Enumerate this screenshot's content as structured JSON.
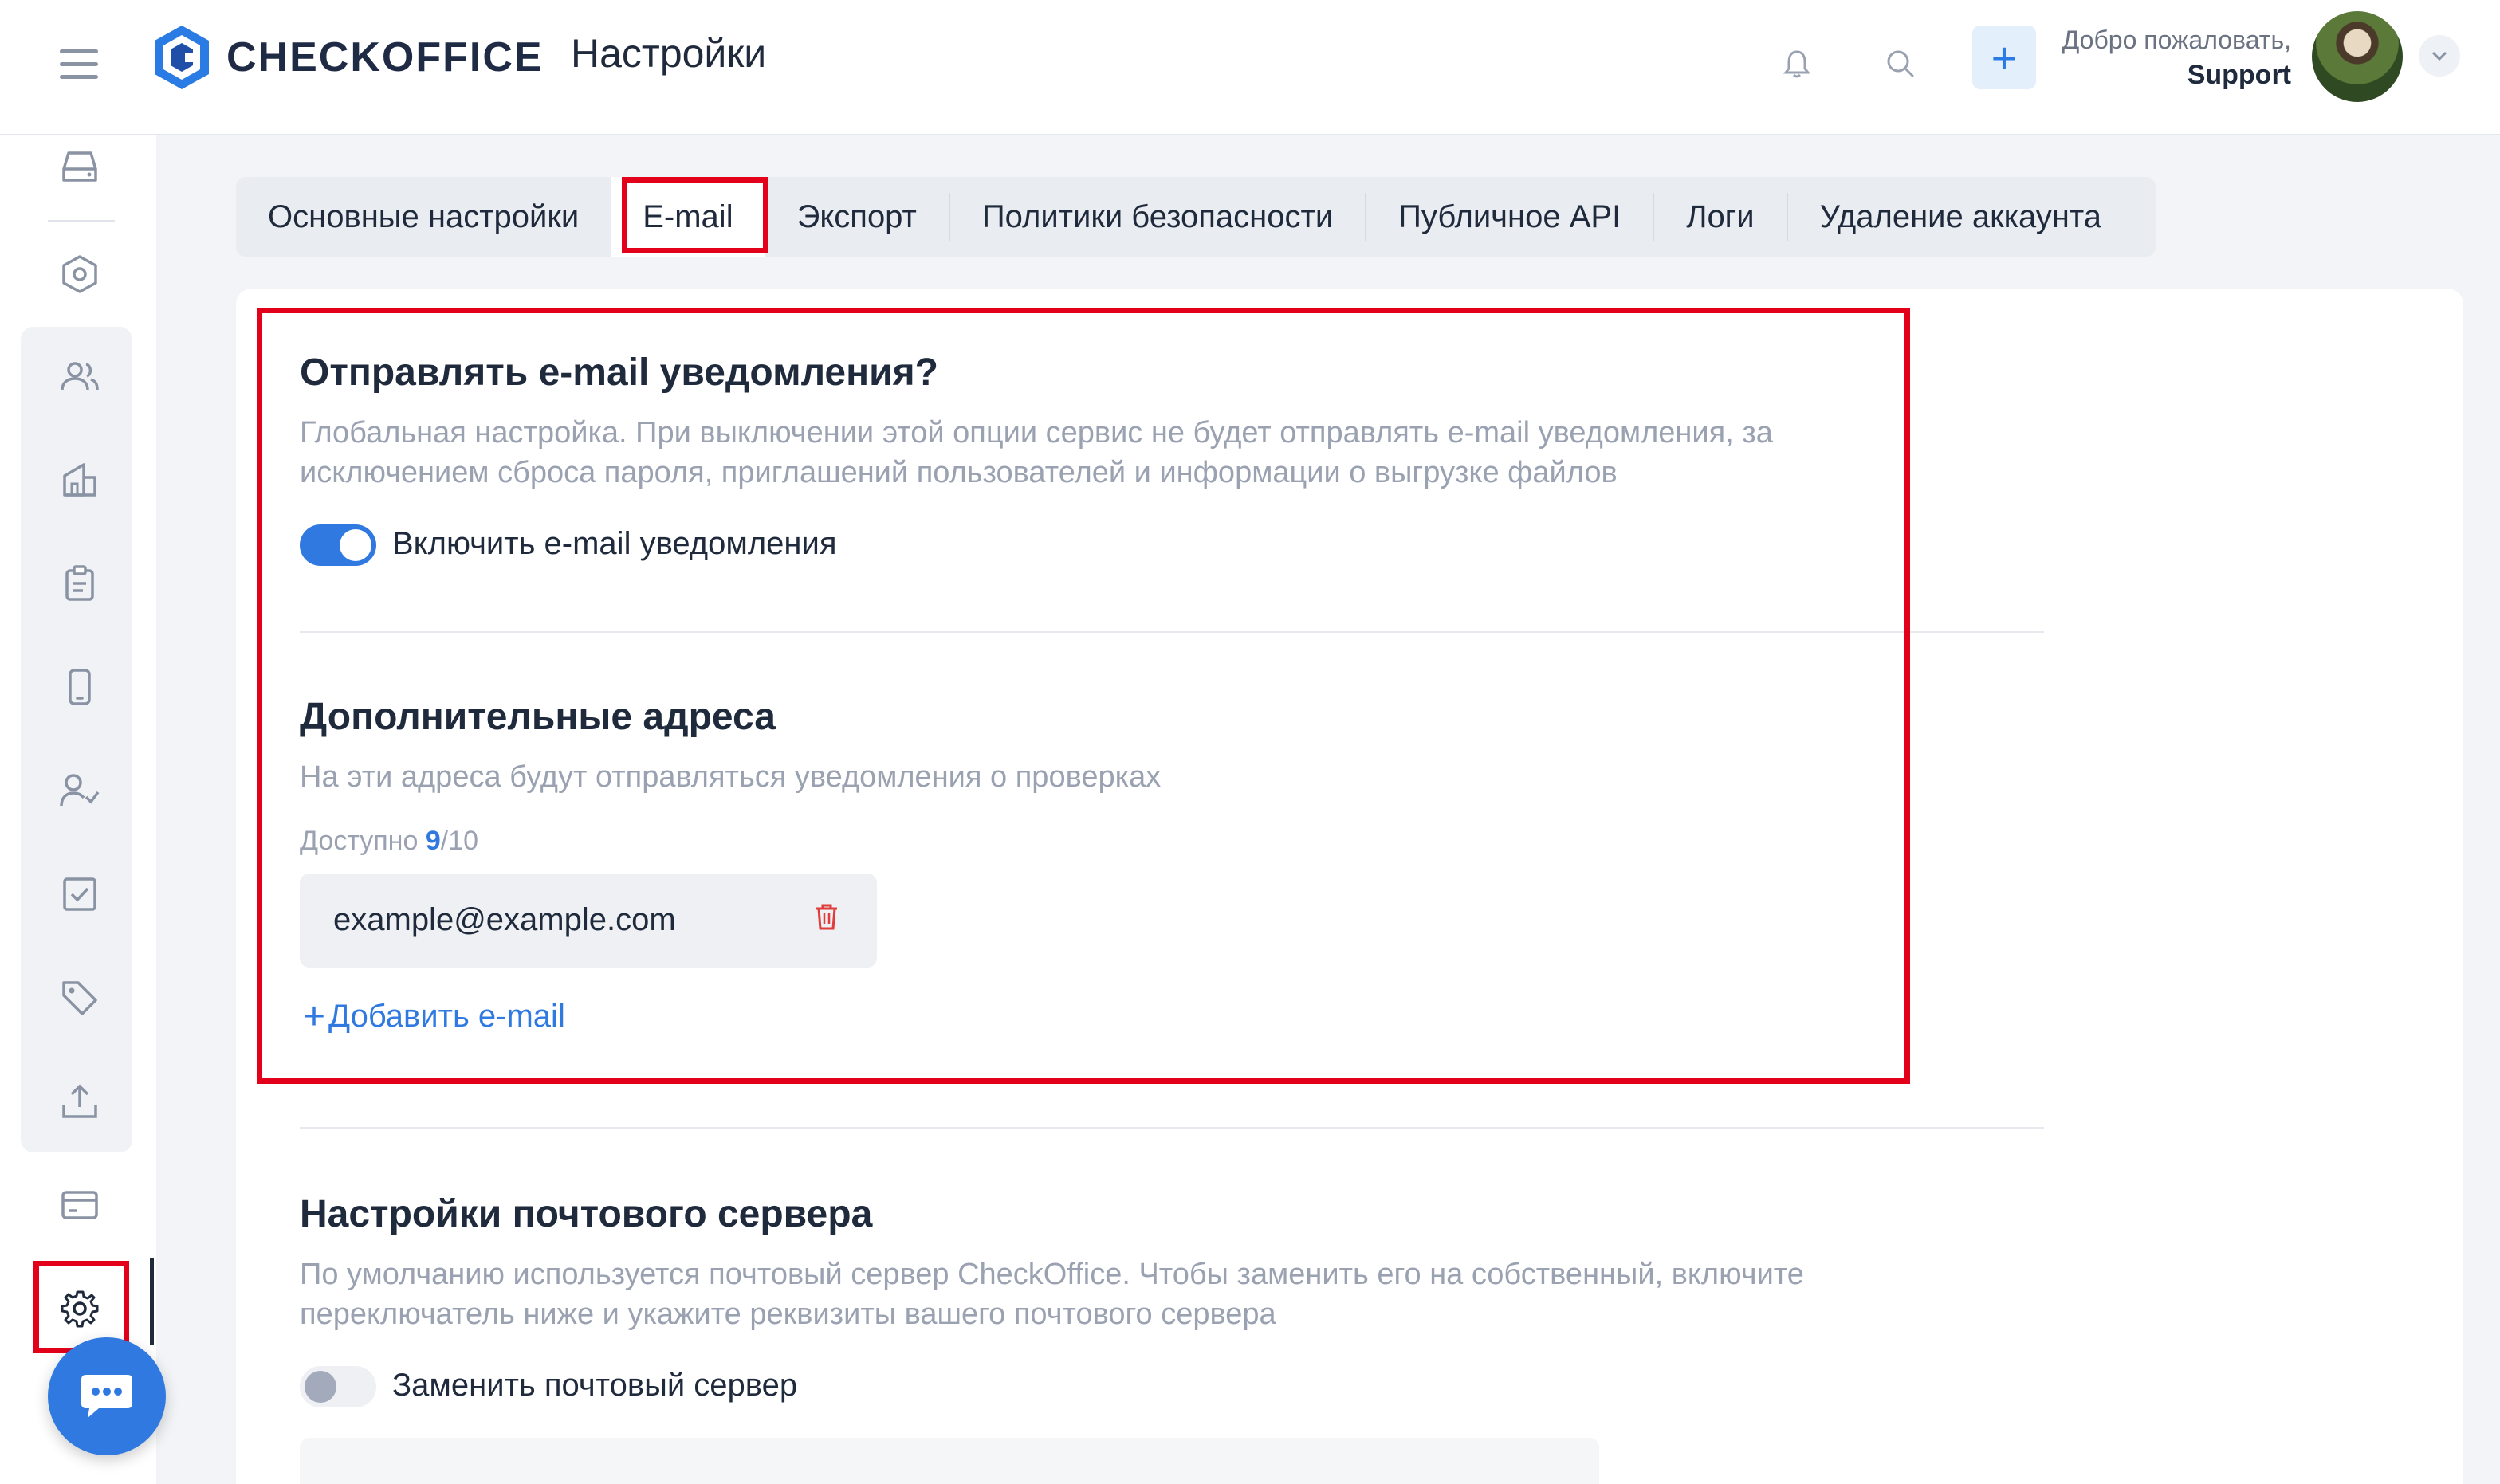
{
  "header": {
    "logo_text": "CHECKOFFICE",
    "page_title": "Настройки",
    "welcome_line": "Добро пожаловать,",
    "user_name": "Support",
    "add_label": "+"
  },
  "tabs": [
    {
      "label": "Основные настройки"
    },
    {
      "label": "E-mail"
    },
    {
      "label": "Экспорт"
    },
    {
      "label": "Политики безопасности"
    },
    {
      "label": "Публичное API"
    },
    {
      "label": "Логи"
    },
    {
      "label": "Удаление аккаунта"
    }
  ],
  "active_tab": "E-mail",
  "notifications": {
    "title": "Отправлять e-mail уведомления?",
    "description": "Глобальная настройка. При выключении этой опции сервис не будет отправлять e-mail уведомления, за исключением сброса пароля, приглашений пользователей и информации о выгрузке файлов",
    "toggle_label": "Включить e-mail уведомления",
    "toggle_on": true
  },
  "extra_addresses": {
    "title": "Дополнительные адреса",
    "description": "На эти адреса будут отправляться уведомления о проверках",
    "available_label": "Доступно ",
    "available_count": "9",
    "available_total": "/10",
    "emails": [
      "example@example.com"
    ],
    "add_label": "Добавить e-mail"
  },
  "mail_server": {
    "title": "Настройки почтового сервера",
    "description": "По умолчанию используется почтовый сервер CheckOffice. Чтобы заменить его на собственный, включите переключатель ниже и укажите реквизиты вашего почтового сервера",
    "toggle_label": "Заменить почтовый сервер",
    "toggle_on": false
  },
  "colors": {
    "accent": "#2f79e0",
    "highlight": "#e2001a",
    "text": "#1f2a3c",
    "muted": "#9aa2b1"
  },
  "sidebar_icons": [
    "storage-icon",
    "hexagon-settings-icon",
    "users-icon",
    "building-icon",
    "clipboard-icon",
    "mobile-icon",
    "user-check-icon",
    "checkbox-icon",
    "tag-icon",
    "upload-icon",
    "card-icon",
    "gear-icon"
  ]
}
